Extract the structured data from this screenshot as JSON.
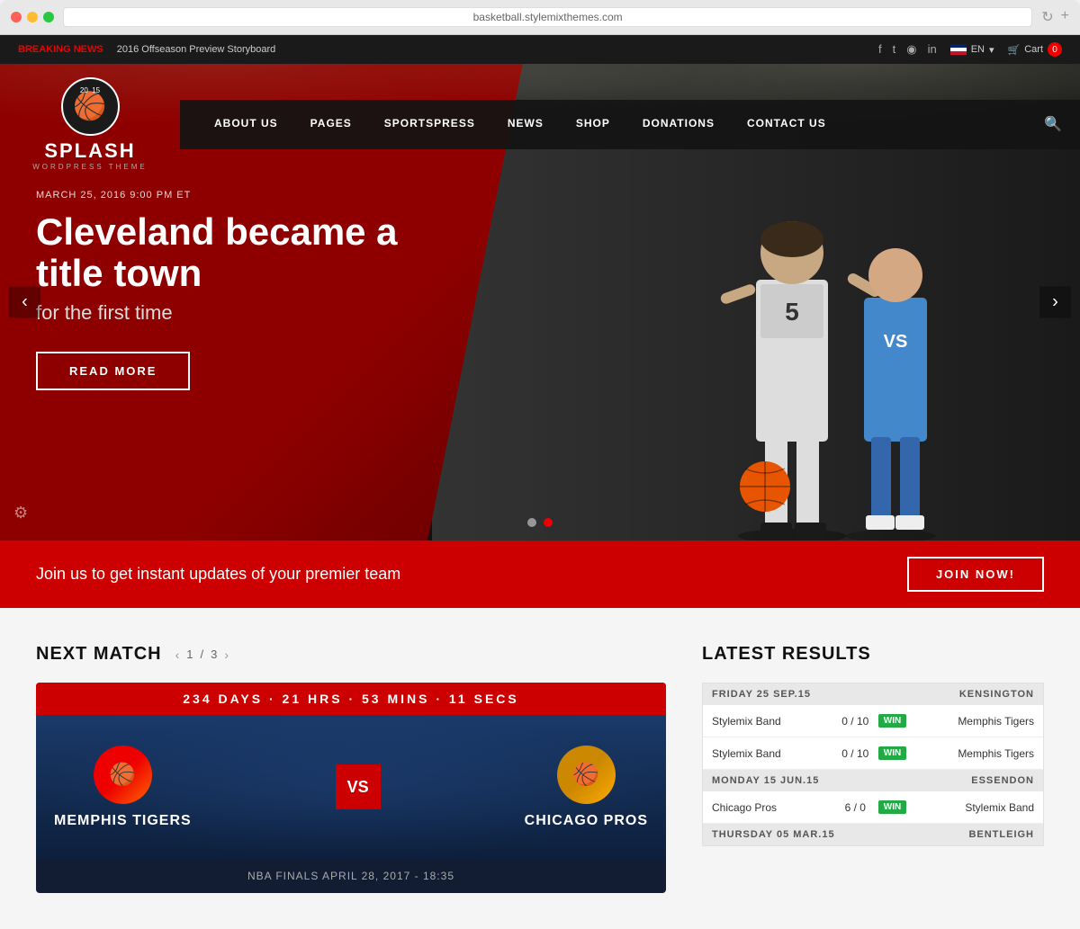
{
  "browser": {
    "url": "basketball.stylemixthemes.com",
    "reload_icon": "↻"
  },
  "topbar": {
    "breaking_news_label": "BREAKING NEWS",
    "news_text": "2016 Offseason Preview Storyboard",
    "social": [
      "f",
      "t",
      "◉",
      "in"
    ],
    "lang": "EN",
    "cart_label": "Cart",
    "cart_count": "0"
  },
  "nav": {
    "logo_year1": "20",
    "logo_year2": "15",
    "logo_name": "SPLASH",
    "logo_sub": "WORDPRESS THEME",
    "items": [
      {
        "label": "ABOUT US"
      },
      {
        "label": "PAGES"
      },
      {
        "label": "SPORTSPRESS"
      },
      {
        "label": "NEWS"
      },
      {
        "label": "SHOP"
      },
      {
        "label": "DONATIONS"
      },
      {
        "label": "CONTACT US"
      }
    ]
  },
  "hero": {
    "date": "MARCH 25, 2016 9:00 PM ET",
    "title": "Cleveland became a title town",
    "subtitle": "for the first time",
    "cta_label": "READ MORE",
    "dot1_active": false,
    "dot2_active": true
  },
  "join_bar": {
    "text": "Join us to get instant updates of your premier team",
    "button_label": "JOIN NOW!"
  },
  "next_match": {
    "section_title": "NEXT MATCH",
    "page_current": "1",
    "page_total": "3",
    "countdown": "234 DAYS  ·  21 HRS  ·  53 MINS  ·  11 SECS",
    "team_home": "MEMPHIS TIGERS",
    "team_away": "CHICAGO PROS",
    "vs_label": "VS",
    "match_info": "NBA FINALS APRIL 28, 2017 - 18:35"
  },
  "latest_results": {
    "section_title": "LATEST RESULTS",
    "date_groups": [
      {
        "date": "FRIDAY 25 SEP.15",
        "venue": "KENSINGTON",
        "results": [
          {
            "team1": "Stylemix Band",
            "score": "0 / 10",
            "badge": "WIN",
            "team2": "Memphis Tigers"
          },
          {
            "team1": "Stylemix Band",
            "score": "0 / 10",
            "badge": "WIN",
            "team2": "Memphis Tigers"
          }
        ]
      },
      {
        "date": "MONDAY 15 JUN.15",
        "venue": "ESSENDON",
        "results": [
          {
            "team1": "Chicago Pros",
            "score": "6 / 0",
            "badge": "WIN",
            "team2": "Stylemix Band"
          }
        ]
      },
      {
        "date": "THURSDAY 05 MAR.15",
        "venue": "BENTLEIGH",
        "results": []
      }
    ]
  },
  "icons": {
    "search": "🔍",
    "cart": "🛒",
    "settings": "⚙",
    "arrow_left": "‹",
    "arrow_right": "›",
    "basketball": "🏀",
    "chevron_left": "<",
    "chevron_right": ">"
  }
}
